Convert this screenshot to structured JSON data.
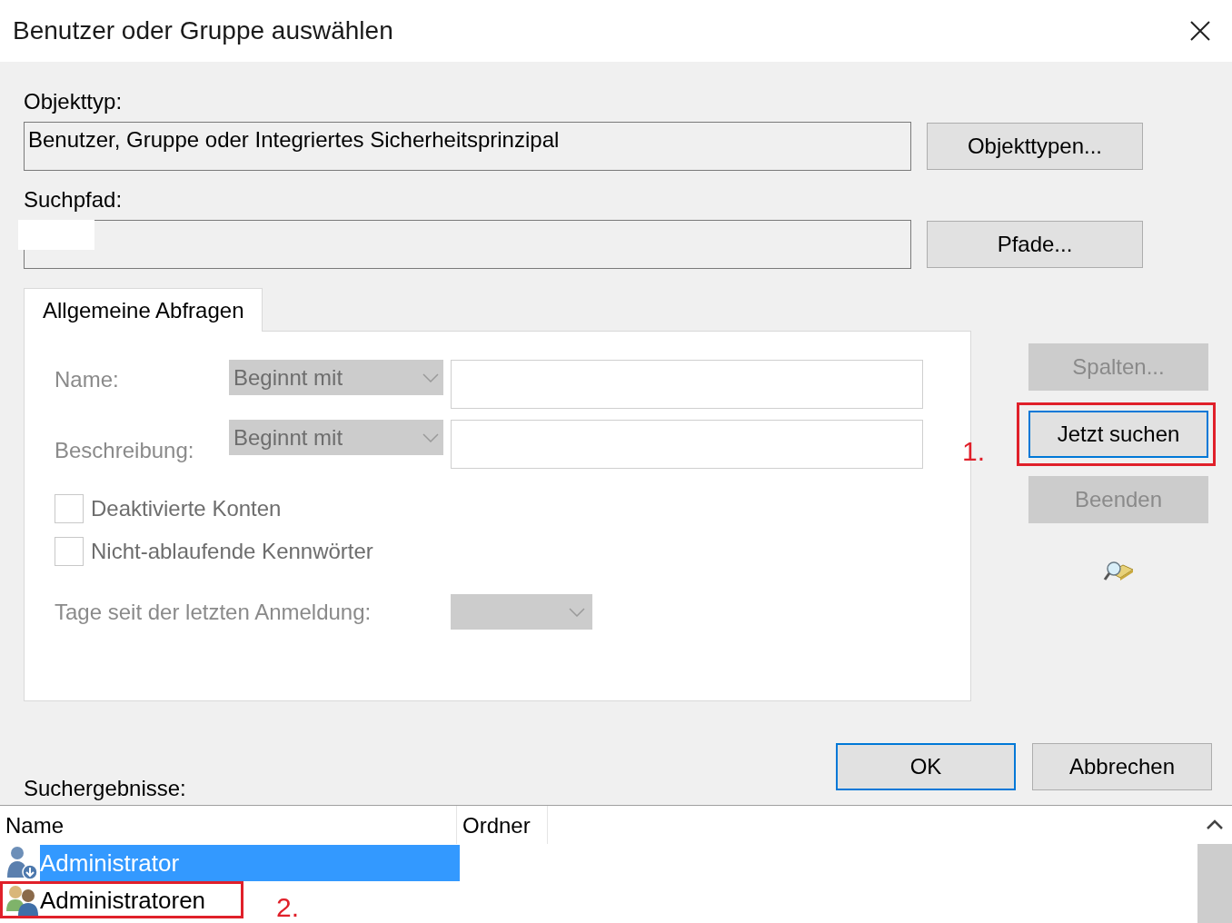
{
  "window": {
    "title": "Benutzer oder Gruppe auswählen"
  },
  "object_type": {
    "label": "Objekttyp:",
    "value": "Benutzer, Gruppe oder Integriertes Sicherheitsprinzipal",
    "button": "Objekttypen..."
  },
  "search_path": {
    "label": "Suchpfad:",
    "button": "Pfade..."
  },
  "tabs": [
    {
      "label": "Allgemeine Abfragen",
      "selected": true
    }
  ],
  "query": {
    "disabled": true,
    "fields": [
      {
        "label": "Name:",
        "operator": "Beginnt mit"
      },
      {
        "label": "Beschreibung:",
        "operator": "Beginnt mit"
      }
    ],
    "checkboxes": [
      {
        "label": "Deaktivierte Konten",
        "checked": false
      },
      {
        "label": "Nicht-ablaufende Kennwörter",
        "checked": false
      }
    ],
    "days_label": "Tage seit der letzten Anmeldung:"
  },
  "side_buttons": [
    {
      "label": "Spalten...",
      "disabled": true,
      "default": false
    },
    {
      "label": "Jetzt suchen",
      "disabled": false,
      "default": true,
      "annotation": "1."
    },
    {
      "label": "Beenden",
      "disabled": true,
      "default": false
    }
  ],
  "dialog_buttons": [
    {
      "label": "OK",
      "default": true
    },
    {
      "label": "Abbrechen",
      "default": false
    }
  ],
  "results": {
    "label": "Suchergebnisse:",
    "columns": [
      "Name",
      "Ordner"
    ],
    "rows": [
      {
        "name": "Administrator",
        "kind": "user",
        "selected": true
      },
      {
        "name": "Administratoren",
        "kind": "group",
        "selected": false,
        "annotation": "2."
      }
    ]
  }
}
